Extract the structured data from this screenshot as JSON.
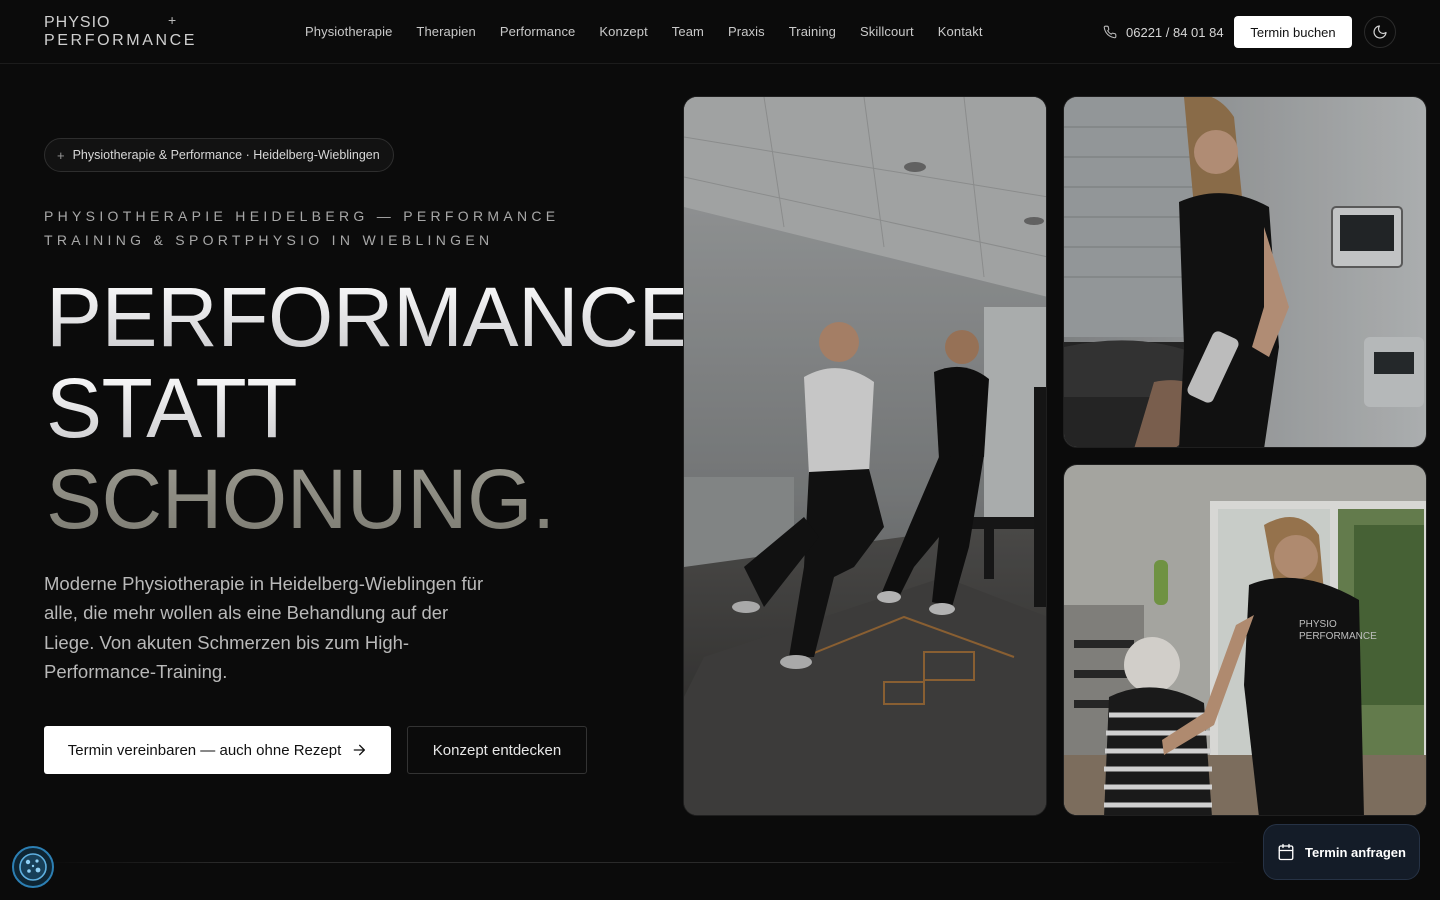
{
  "brand": {
    "line1": "PHYSIO",
    "line2": "PERFORMANCE",
    "mark": "+"
  },
  "nav": {
    "items": [
      {
        "label": "Physiotherapie"
      },
      {
        "label": "Therapien"
      },
      {
        "label": "Performance"
      },
      {
        "label": "Konzept"
      },
      {
        "label": "Team"
      },
      {
        "label": "Praxis"
      },
      {
        "label": "Training"
      },
      {
        "label": "Skillcourt"
      },
      {
        "label": "Kontakt"
      }
    ]
  },
  "header": {
    "phone": "06221 / 84 01 84",
    "phone_icon": "phone-icon",
    "book_label": "Termin buchen",
    "theme_icon": "moon-icon"
  },
  "hero": {
    "pill_icon": "+",
    "pill_label": "Physiotherapie & Performance · Heidelberg-Wieblingen",
    "eyebrow": "PHYSIOTHERAPIE HEIDELBERG — PERFORMANCE TRAINING & SPORTPHYSIO IN WIEBLINGEN",
    "headline": [
      "PERFORMANCE",
      "STATT",
      "SCHONUNG."
    ],
    "lead": "Moderne Physiotherapie in Heidelberg-Wieblingen für alle, die mehr wollen als eine Behandlung auf der Liege. Von akuten Schmerzen bis zum High-Performance-Training.",
    "cta_primary": "Termin vereinbaren — auch ohne Rezept",
    "cta_primary_icon": "arrow-right-icon",
    "cta_secondary": "Konzept entdecken"
  },
  "floating": {
    "request_label": "Termin anfragen",
    "request_icon": "calendar-icon",
    "cookie_icon": "cookie-icon"
  },
  "colors": {
    "background": "#0b0b0b",
    "text": "#e8e8e8",
    "muted": "#a8a8a8",
    "accent_headline_3": "#8e8e84",
    "button_bg": "#ffffff",
    "cookie_ring": "#2c7fb3",
    "fab_bg": "#141c28"
  }
}
